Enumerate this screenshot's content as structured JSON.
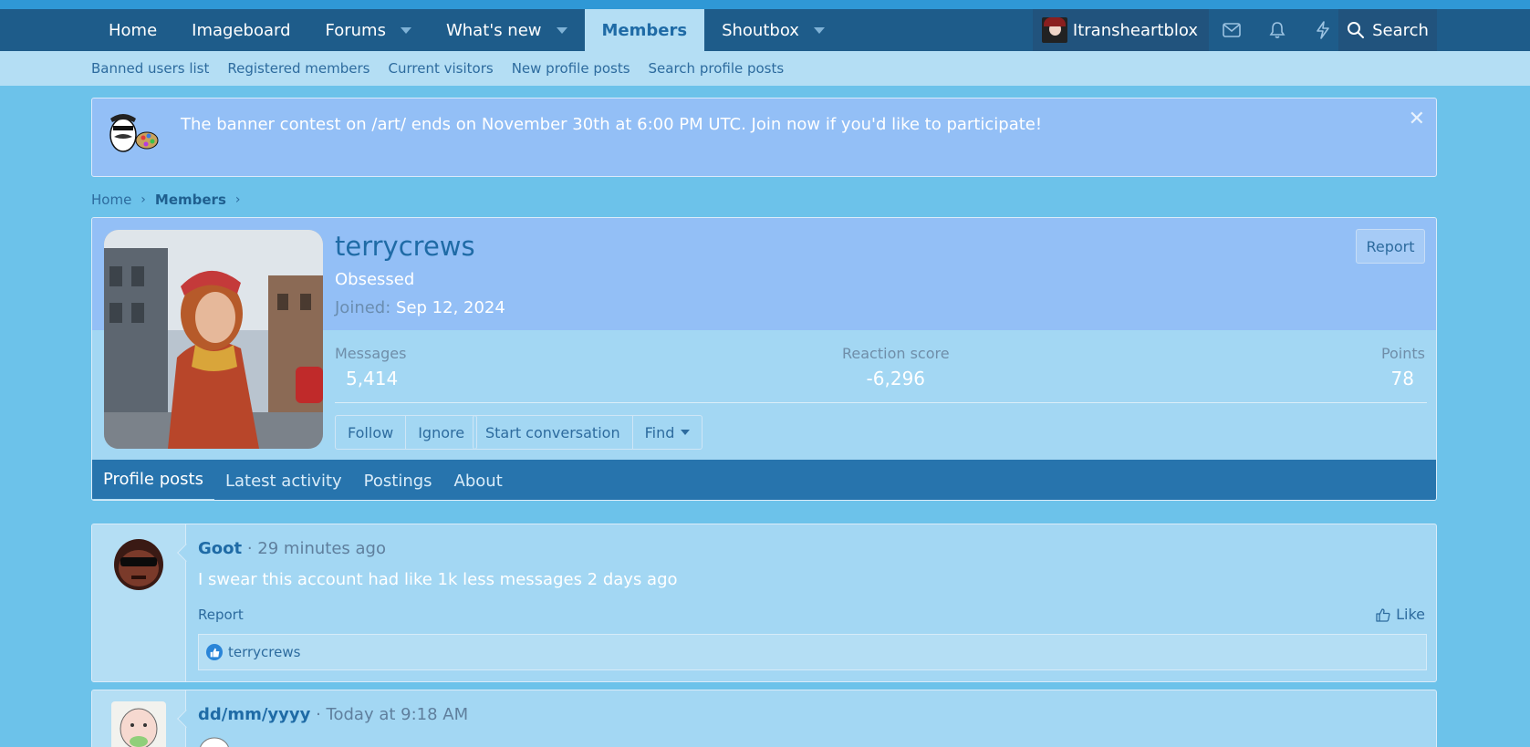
{
  "nav": {
    "tabs": [
      {
        "label": "Home"
      },
      {
        "label": "Imageboard"
      },
      {
        "label": "Forums"
      },
      {
        "label": "What's new"
      },
      {
        "label": "Members"
      },
      {
        "label": "Shoutbox"
      }
    ],
    "username": "Itransheartblox",
    "search_label": "Search"
  },
  "subnav": {
    "items": [
      "Banned users list",
      "Registered members",
      "Current visitors",
      "New profile posts",
      "Search profile posts"
    ]
  },
  "notice": {
    "text": "The banner contest on /art/ ends on November 30th at 6:00 PM UTC. Join now if you'd like to participate!",
    "close": "✕"
  },
  "breadcrumb": {
    "items": [
      "Home",
      "Members"
    ]
  },
  "profile": {
    "name": "terrycrews",
    "title": "Obsessed",
    "joined_label": "Joined:",
    "joined_value": "Sep 12, 2024",
    "report": "Report",
    "stats": {
      "messages_label": "Messages",
      "messages_value": "5,414",
      "reaction_label": "Reaction score",
      "reaction_value": "-6,296",
      "points_label": "Points",
      "points_value": "78"
    },
    "buttons": {
      "follow": "Follow",
      "ignore": "Ignore",
      "start_conversation": "Start conversation",
      "find": "Find"
    },
    "tabs": [
      "Profile posts",
      "Latest activity",
      "Postings",
      "About"
    ]
  },
  "posts": [
    {
      "username": "Goot",
      "time": "· 29 minutes ago",
      "body": "I swear this account had like 1k less messages 2 days ago",
      "report": "Report",
      "like": "Like",
      "reacted_by": "terrycrews"
    },
    {
      "username": "dd/mm/yyyy",
      "time": "· Today at 9:18 AM"
    }
  ]
}
